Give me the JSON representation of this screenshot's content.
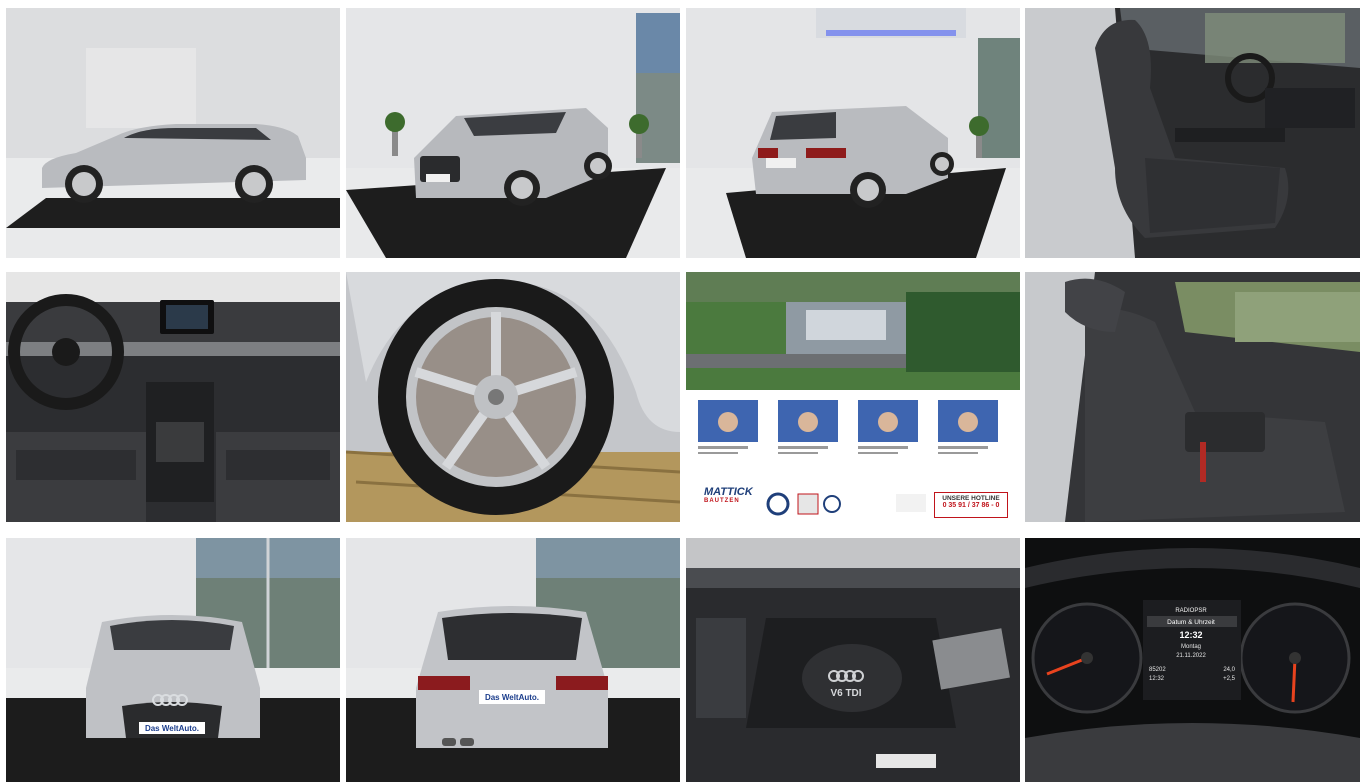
{
  "gallery": {
    "photos": [
      {
        "label": "Side view"
      },
      {
        "label": "Front three-quarter view"
      },
      {
        "label": "Rear three-quarter view"
      },
      {
        "label": "Front seats interior"
      },
      {
        "label": "Dashboard and steering wheel"
      },
      {
        "label": "Alloy wheel"
      },
      {
        "label": "Dealership aerial and contacts"
      },
      {
        "label": "Rear seats interior"
      },
      {
        "label": "Front view"
      },
      {
        "label": "Rear view"
      },
      {
        "label": "Engine bay"
      },
      {
        "label": "Instrument cluster"
      }
    ]
  },
  "plates": {
    "front": "Das WeltAuto.",
    "rear": "Das WeltAuto."
  },
  "dealer": {
    "logo": "MATTICK",
    "city": "BAUTZEN",
    "hotline_title": "UNSERE HOTLINE",
    "hotline_number": "0 35 91 / 37 86 - 0"
  },
  "engine": {
    "badge": "V6 TDI"
  },
  "cluster": {
    "station": "RADIOPSR",
    "menu": "Datum & Uhrzeit",
    "time": "12:32",
    "day": "Montag",
    "date": "21.11.2022",
    "odometer": "85202",
    "clock": "12:32",
    "range": "24,0",
    "temp": "+2,5"
  },
  "colors": {
    "background": "#ffffff",
    "car_silver": "#b9bbbf",
    "floor_black": "#1c1c1c",
    "showroom_wall": "#e6e7e9",
    "interior_dark": "#2a2b2d",
    "needle_red": "#e8431e",
    "hotline_red": "#c0141b"
  }
}
